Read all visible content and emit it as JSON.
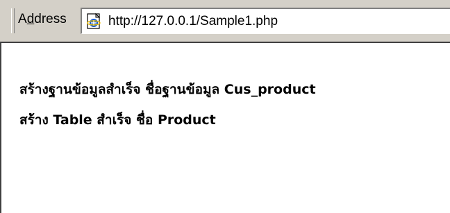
{
  "address_bar": {
    "label_prefix": "A",
    "label_accel": "d",
    "label_suffix": "dress",
    "url": "http://127.0.0.1/Sample1.php",
    "icon": "ie-page-icon"
  },
  "content": {
    "messages": [
      "สร้างฐานข้อมูลสำเร็จ ชื่อฐานข้อมูล Cus_product",
      "สร้าง Table สำเร็จ ชื่อ Product"
    ]
  }
}
